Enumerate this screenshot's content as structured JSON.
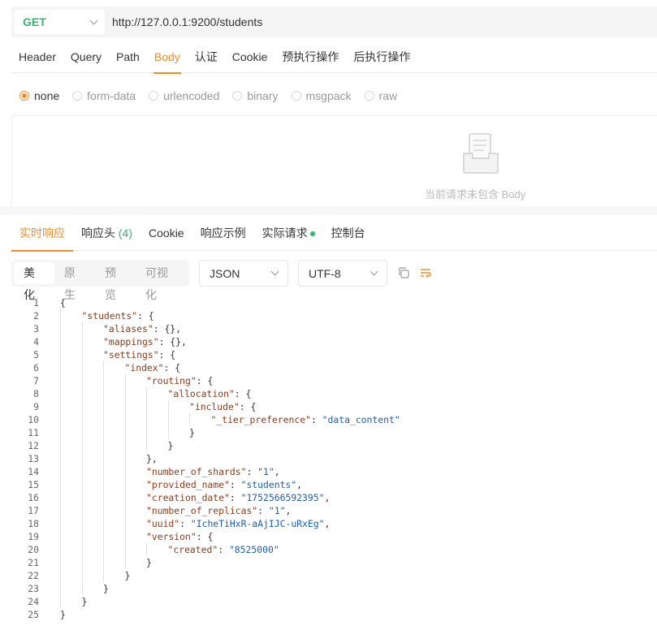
{
  "request": {
    "method": "GET",
    "url": "http://127.0.0.1:9200/students",
    "method_color": "#2eb872",
    "tabs": [
      "Header",
      "Query",
      "Path",
      "Body",
      "认证",
      "Cookie",
      "预执行操作",
      "后执行操作"
    ],
    "active_tab": "Body"
  },
  "body": {
    "options": [
      "none",
      "form-data",
      "urlencoded",
      "binary",
      "msgpack",
      "raw"
    ],
    "selected": "none",
    "empty_text": "当前请求未包含 Body"
  },
  "response": {
    "tabs": {
      "realtime": "实时响应",
      "headers": "响应头",
      "headers_count": "(4)",
      "cookie": "Cookie",
      "example": "响应示例",
      "actual": "实际请求",
      "console": "控制台"
    },
    "view_modes": [
      "美化",
      "原生",
      "预览",
      "可视化"
    ],
    "active_view": "美化",
    "format": "JSON",
    "encoding": "UTF-8",
    "accent_color": "#f08c2c"
  },
  "code_lines": [
    [
      {
        "t": "p",
        "v": "{"
      }
    ],
    [
      {
        "t": "k",
        "v": "\"students\""
      },
      {
        "t": "p",
        "v": ": {"
      }
    ],
    [
      {
        "t": "k",
        "v": "\"aliases\""
      },
      {
        "t": "p",
        "v": ": {},"
      }
    ],
    [
      {
        "t": "k",
        "v": "\"mappings\""
      },
      {
        "t": "p",
        "v": ": {},"
      }
    ],
    [
      {
        "t": "k",
        "v": "\"settings\""
      },
      {
        "t": "p",
        "v": ": {"
      }
    ],
    [
      {
        "t": "k",
        "v": "\"index\""
      },
      {
        "t": "p",
        "v": ": {"
      }
    ],
    [
      {
        "t": "k",
        "v": "\"routing\""
      },
      {
        "t": "p",
        "v": ": {"
      }
    ],
    [
      {
        "t": "k",
        "v": "\"allocation\""
      },
      {
        "t": "p",
        "v": ": {"
      }
    ],
    [
      {
        "t": "k",
        "v": "\"include\""
      },
      {
        "t": "p",
        "v": ": {"
      }
    ],
    [
      {
        "t": "k",
        "v": "\"_tier_preference\""
      },
      {
        "t": "p",
        "v": ": "
      },
      {
        "t": "s",
        "v": "\"data_content\""
      }
    ],
    [
      {
        "t": "p",
        "v": "}"
      }
    ],
    [
      {
        "t": "p",
        "v": "}"
      }
    ],
    [
      {
        "t": "p",
        "v": "},"
      }
    ],
    [
      {
        "t": "k",
        "v": "\"number_of_shards\""
      },
      {
        "t": "p",
        "v": ": "
      },
      {
        "t": "s",
        "v": "\"1\""
      },
      {
        "t": "p",
        "v": ","
      }
    ],
    [
      {
        "t": "k",
        "v": "\"provided_name\""
      },
      {
        "t": "p",
        "v": ": "
      },
      {
        "t": "s",
        "v": "\"students\""
      },
      {
        "t": "p",
        "v": ","
      }
    ],
    [
      {
        "t": "k",
        "v": "\"creation_date\""
      },
      {
        "t": "p",
        "v": ": "
      },
      {
        "t": "s",
        "v": "\"1752566592395\""
      },
      {
        "t": "p",
        "v": ","
      }
    ],
    [
      {
        "t": "k",
        "v": "\"number_of_replicas\""
      },
      {
        "t": "p",
        "v": ": "
      },
      {
        "t": "s",
        "v": "\"1\""
      },
      {
        "t": "p",
        "v": ","
      }
    ],
    [
      {
        "t": "k",
        "v": "\"uuid\""
      },
      {
        "t": "p",
        "v": ": "
      },
      {
        "t": "s",
        "v": "\"IcheTiHxR-aAjIJC-uRxEg\""
      },
      {
        "t": "p",
        "v": ","
      }
    ],
    [
      {
        "t": "k",
        "v": "\"version\""
      },
      {
        "t": "p",
        "v": ": {"
      }
    ],
    [
      {
        "t": "k",
        "v": "\"created\""
      },
      {
        "t": "p",
        "v": ": "
      },
      {
        "t": "s",
        "v": "\"8525000\""
      }
    ],
    [
      {
        "t": "p",
        "v": "}"
      }
    ],
    [
      {
        "t": "p",
        "v": "}"
      }
    ],
    [
      {
        "t": "p",
        "v": "}"
      }
    ],
    [
      {
        "t": "p",
        "v": "}"
      }
    ],
    [
      {
        "t": "p",
        "v": "}"
      }
    ]
  ]
}
